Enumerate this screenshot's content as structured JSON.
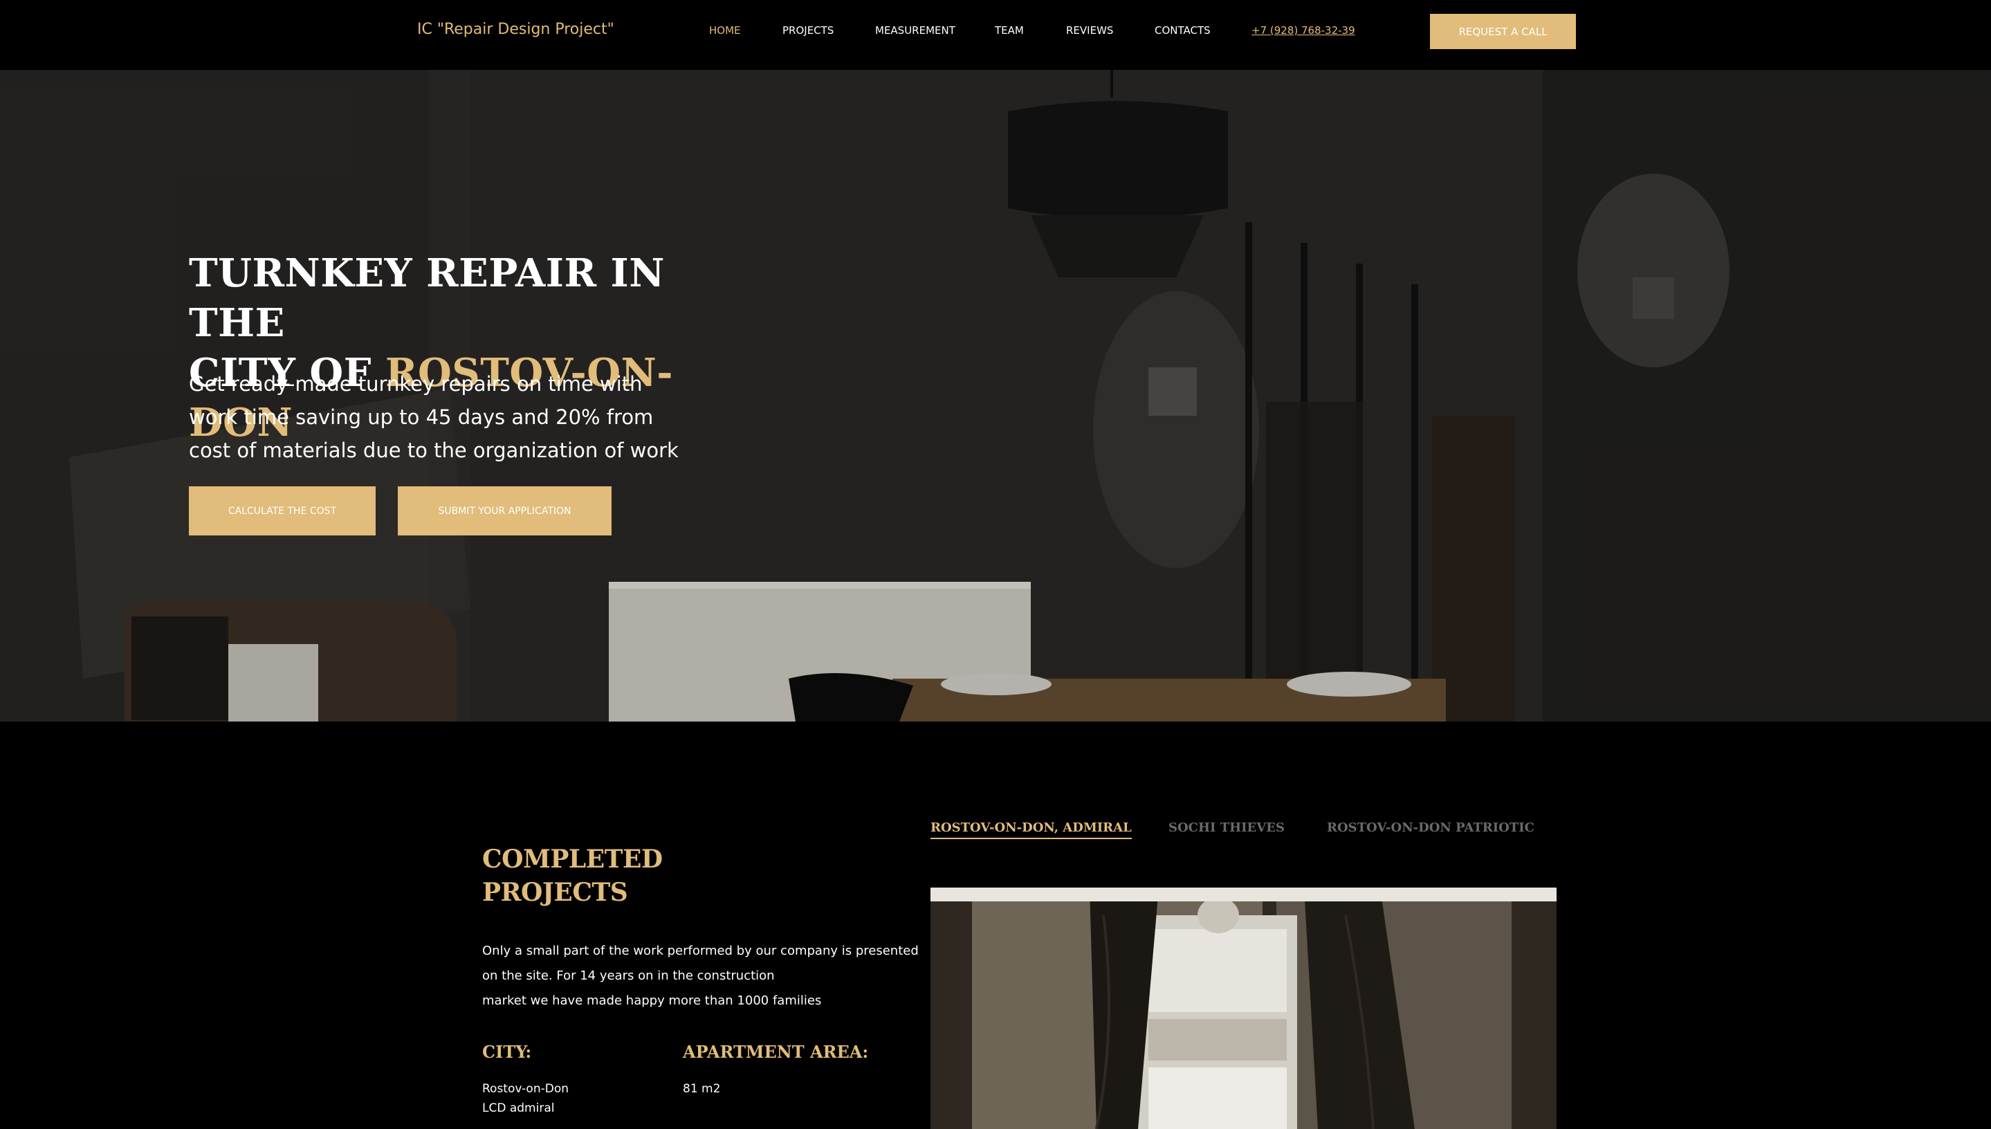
{
  "header": {
    "logo": "IC \"Repair Design Project\"",
    "nav": [
      {
        "label": "HOME",
        "active": true
      },
      {
        "label": "PROJECTS",
        "active": false
      },
      {
        "label": "MEASUREMENT",
        "active": false
      },
      {
        "label": "TEAM",
        "active": false
      },
      {
        "label": "REVIEWS",
        "active": false
      },
      {
        "label": "CONTACTS",
        "active": false
      }
    ],
    "phone": "+7 (928) 768-32-39",
    "cta_label": "REQUEST A CALL"
  },
  "hero": {
    "title_line1": "TURNKEY REPAIR IN THE",
    "title_line2_prefix": "CITY OF ",
    "title_highlight": "ROSTOV-ON-DON",
    "subtitle": "Get ready-made turnkey repairs on time with work time saving up to 45 days and 20% from cost of materials due to the organization of work",
    "btn_calculate": "CALCULATE THE COST",
    "btn_submit": "SUBMIT YOUR APPLICATION"
  },
  "projects": {
    "title_line1": "COMPLETED",
    "title_line2": "PROJECTS",
    "description_line1": "Only a small part of the work performed by our company is presented",
    "description_line2": "on the site. For 14 years on in the construction",
    "description_line3": "market we have made happy more than 1000 families",
    "city_label": "CITY:",
    "city_value_line1": "Rostov-on-Don",
    "city_value_line2": "LCD admiral",
    "area_label": "APARTMENT AREA:",
    "area_value": "81 m2",
    "tabs": [
      {
        "label": "ROSTOV-ON-DON, ADMIRAL",
        "active": true
      },
      {
        "label": "SOCHI THIEVES",
        "active": false
      },
      {
        "label": "ROSTOV-ON-DON PATRIOTIC",
        "active": false
      }
    ]
  },
  "colors": {
    "accent": "#e1bc7a",
    "background": "#000000",
    "tab_inactive": "#6a6a6a"
  }
}
